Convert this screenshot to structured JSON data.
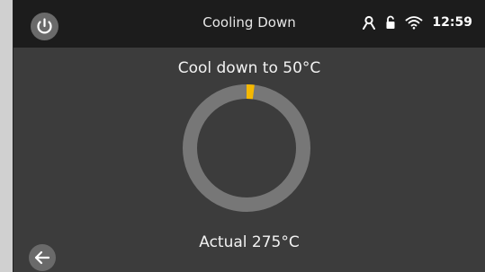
{
  "topbar": {
    "title": "Cooling Down",
    "time": "12:59",
    "icons": [
      "power-icon",
      "user-icon",
      "lock-icon",
      "wifi-icon"
    ]
  },
  "main": {
    "target_text": "Cool down to 50°C",
    "actual_text": "Actual 275°C",
    "progress_fraction": 0.02,
    "progress_color": "#f5b800",
    "ring_color": "#777777"
  },
  "footer": {
    "icons": [
      "arrow-left-icon"
    ]
  }
}
